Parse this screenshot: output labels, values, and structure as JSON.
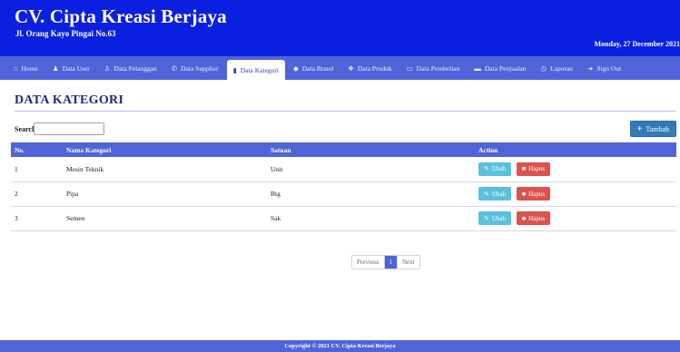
{
  "header": {
    "brand": "CV. Cipta Kreasi Berjaya",
    "address": "Jl. Orang Kayo Pingai No.63",
    "date": "Monday, 27 December 2021"
  },
  "nav": [
    {
      "label": "Home",
      "icon": "home-icon"
    },
    {
      "label": "Data User",
      "icon": "user-icon"
    },
    {
      "label": "Data Pelanggan",
      "icon": "users-icon"
    },
    {
      "label": "Data Supplier",
      "icon": "phone-icon"
    },
    {
      "label": "Data Kategori",
      "icon": "bookmark-icon",
      "active": true
    },
    {
      "label": "Data Brand",
      "icon": "tag-icon"
    },
    {
      "label": "Data Produk",
      "icon": "cubes-icon"
    },
    {
      "label": "Data Pembelian",
      "icon": "credit-card-icon"
    },
    {
      "label": "Data Penjualan",
      "icon": "cart-icon"
    },
    {
      "label": "Laporan",
      "icon": "report-icon"
    },
    {
      "label": "Sign Out",
      "icon": "sign-out-icon"
    }
  ],
  "page": {
    "title": "DATA KATEGORI",
    "search_label": "Search:",
    "search_value": "",
    "add_button": "Tambah"
  },
  "table": {
    "headers": [
      "No.",
      "Nama Kategori",
      "Satuan",
      "Action"
    ],
    "rows": [
      {
        "no": "1",
        "nama": "Mesin Teknik",
        "satuan": "Unit"
      },
      {
        "no": "2",
        "nama": "Pipa",
        "satuan": "Btg"
      },
      {
        "no": "3",
        "nama": "Semen",
        "satuan": "Sak"
      }
    ],
    "edit_label": "Ubah",
    "delete_label": "Hapus"
  },
  "pagination": {
    "previous": "Previous",
    "current": "1",
    "next": "Next"
  },
  "footer": {
    "text": "Copyright © 2021 CV. Cipta Kreasi Berjaya"
  },
  "colors": {
    "header_bg": "#0b1fe0",
    "nav_bg": "#4f64d9",
    "edit_button": "#5bc0de",
    "delete_button": "#d9534f",
    "add_button": "#2f7cb8"
  }
}
